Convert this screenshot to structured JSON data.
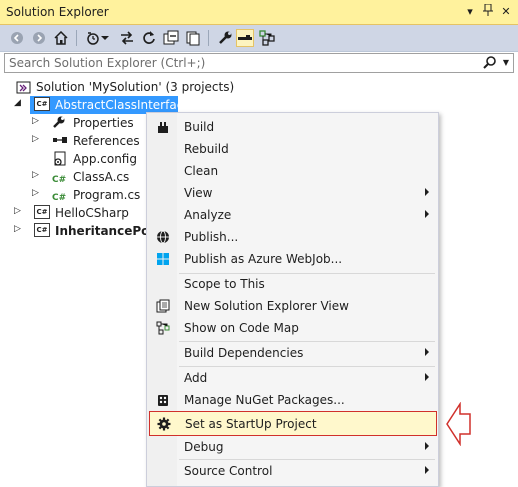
{
  "window": {
    "title": "Solution Explorer",
    "controls": {
      "dropdown": "▾",
      "pin": "⊥",
      "close": "✕"
    }
  },
  "search": {
    "placeholder": "Search Solution Explorer (Ctrl+;)"
  },
  "tree": {
    "solution": "Solution 'MySolution' (3 projects)",
    "items": [
      {
        "label": "AbstractClassInterface",
        "kind": "project",
        "selected": true
      },
      {
        "label": "Properties",
        "kind": "properties"
      },
      {
        "label": "References",
        "kind": "references"
      },
      {
        "label": "App.config",
        "kind": "config"
      },
      {
        "label": "ClassA.cs",
        "kind": "csfile"
      },
      {
        "label": "Program.cs",
        "kind": "csfile"
      },
      {
        "label": "HelloCSharp",
        "kind": "project"
      },
      {
        "label": "InheritancePolym",
        "kind": "project",
        "bold": true
      }
    ],
    "project_badge": "C#",
    "cs_badge": "C#"
  },
  "context_menu": {
    "items": [
      {
        "label": "Build",
        "icon": "build-icon"
      },
      {
        "label": "Rebuild"
      },
      {
        "label": "Clean"
      },
      {
        "label": "View",
        "submenu": true
      },
      {
        "label": "Analyze",
        "submenu": true
      },
      {
        "label": "Publish...",
        "icon": "globe-icon"
      },
      {
        "label": "Publish as Azure WebJob...",
        "icon": "windows-icon"
      },
      {
        "label": "Scope to This"
      },
      {
        "label": "New Solution Explorer View",
        "icon": "new-view-icon"
      },
      {
        "label": "Show on Code Map",
        "icon": "code-map-icon"
      },
      {
        "label": "Build Dependencies",
        "submenu": true
      },
      {
        "label": "Add",
        "submenu": true
      },
      {
        "label": "Manage NuGet Packages...",
        "icon": "nuget-icon"
      },
      {
        "label": "Set as StartUp Project",
        "icon": "gear-icon",
        "highlighted": true
      },
      {
        "label": "Debug",
        "submenu": true
      },
      {
        "label": "Source Control",
        "submenu": true
      }
    ]
  },
  "colors": {
    "title_bar": "#fff29d",
    "toolbar": "#cfd6e5",
    "selection": "#3399ff",
    "highlight_border": "#d0302b",
    "cs_green": "#388a34"
  }
}
